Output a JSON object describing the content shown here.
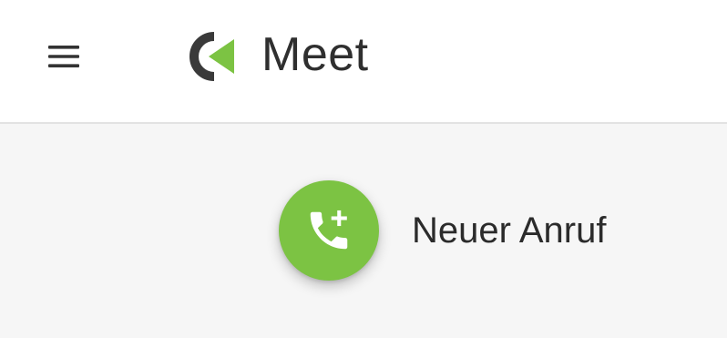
{
  "header": {
    "app_name": "Meet",
    "menu_icon": "hamburger-menu-icon",
    "logo_icon": "meet-logo-icon",
    "logo_colors": {
      "dark": "#3a3a3a",
      "accent": "#7cc343"
    }
  },
  "main": {
    "new_call_label": "Neuer Anruf",
    "new_call_icon": "add-call-icon",
    "accent_color": "#7cc343"
  }
}
